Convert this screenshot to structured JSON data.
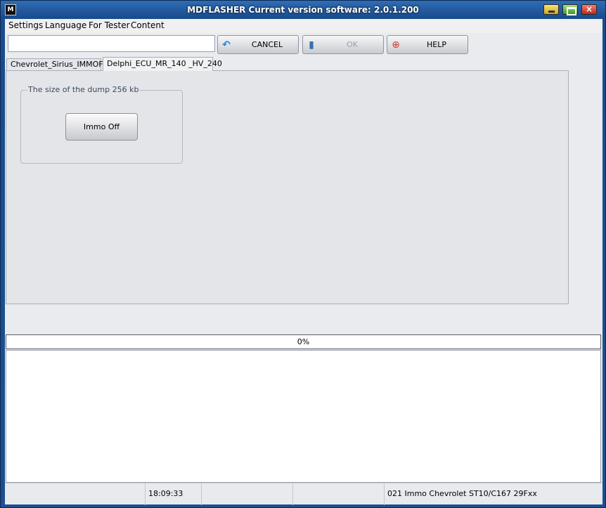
{
  "window": {
    "title": "MDFLASHER  Current version software: 2.0.1.200",
    "app_icon": "md-logo-icon",
    "controls": {
      "minimize": "minimize-icon",
      "maximize": "maximize-icon",
      "close": "×"
    }
  },
  "menu": {
    "items": [
      {
        "label": "Settings"
      },
      {
        "label": "Language"
      },
      {
        "label": "For Tester"
      },
      {
        "label": "Content"
      }
    ]
  },
  "toolbar": {
    "input_value": "",
    "cancel_label": "CANCEL",
    "ok_label": "OK",
    "help_label": "HELP",
    "cancel_icon": "undo-arrow-icon",
    "ok_icon": "exit-door-icon",
    "help_icon": "lifebuoy-icon"
  },
  "tabs": [
    {
      "label": "Chevrolet_Sirius_IMMOFF",
      "active": false
    },
    {
      "label": "Delphi_ECU_MR_140 _HV_240",
      "active": true
    }
  ],
  "panel": {
    "group_caption": "The size of the dump 256 kb",
    "immo_button_label": "Immo Off"
  },
  "progress": {
    "text": "0%",
    "value": 0
  },
  "status": {
    "cells": [
      "",
      "18:09:33",
      "",
      "",
      "021 Immo Chevrolet ST10/C167 29Fxx"
    ]
  },
  "colors": {
    "titlebar": "#1a4c8e",
    "client_bg": "#e9ebee",
    "panel_bg": "#e3e5e9"
  }
}
